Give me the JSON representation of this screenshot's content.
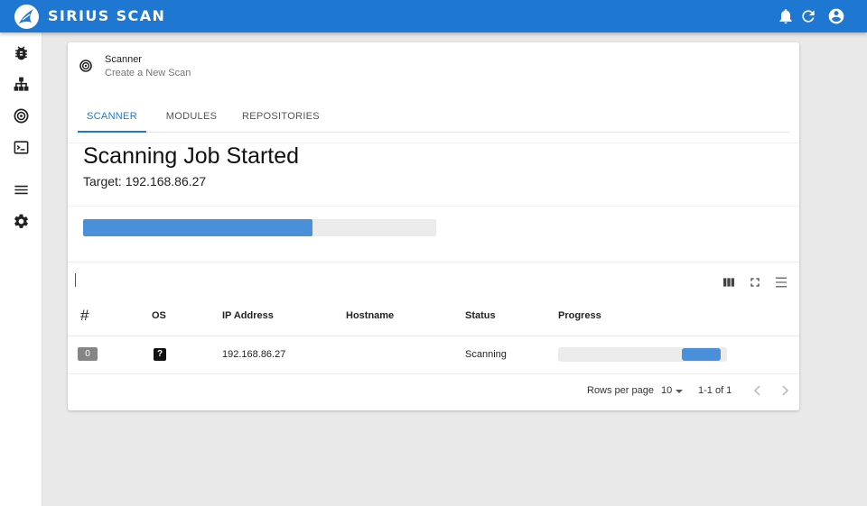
{
  "header": {
    "brand": "SIRIUS SCAN",
    "icons": [
      "bell-icon",
      "refresh-icon",
      "account-circle-icon"
    ],
    "accent": "#1e78d2"
  },
  "sidebar": {
    "items": [
      {
        "icon": "bug-icon"
      },
      {
        "icon": "sitemap-icon"
      },
      {
        "icon": "radar-icon"
      },
      {
        "icon": "terminal-icon"
      },
      {
        "icon": "menu-icon"
      },
      {
        "icon": "gear-icon"
      }
    ]
  },
  "card": {
    "title": "Scanner",
    "subtitle": "Create a New Scan",
    "icon": "radar-icon"
  },
  "tabs": [
    {
      "label": "SCANNER",
      "active": true
    },
    {
      "label": "MODULES",
      "active": false
    },
    {
      "label": "REPOSITORIES",
      "active": false
    }
  ],
  "job": {
    "title": "Scanning Job Started",
    "target": "Target: 192.168.86.27",
    "progress": 0.65
  },
  "table": {
    "toolbar_icons": [
      "view-column-icon",
      "fullscreen-icon",
      "density-icon"
    ],
    "columns": [
      "#",
      "OS",
      "IP Address",
      "Hostname",
      "Status",
      "Progress"
    ],
    "rows": [
      {
        "index": "0",
        "os": "?",
        "ip": "192.168.86.27",
        "hostname": "",
        "status": "Scanning",
        "progress_start": 0.73,
        "progress_end": 0.96
      }
    ]
  },
  "pagination": {
    "rows_per_page_label": "Rows per page",
    "rows_per_page": "10",
    "range": "1-1 of 1"
  },
  "colors": {
    "progress": "#4a8fd9",
    "track": "#ebebeb"
  }
}
